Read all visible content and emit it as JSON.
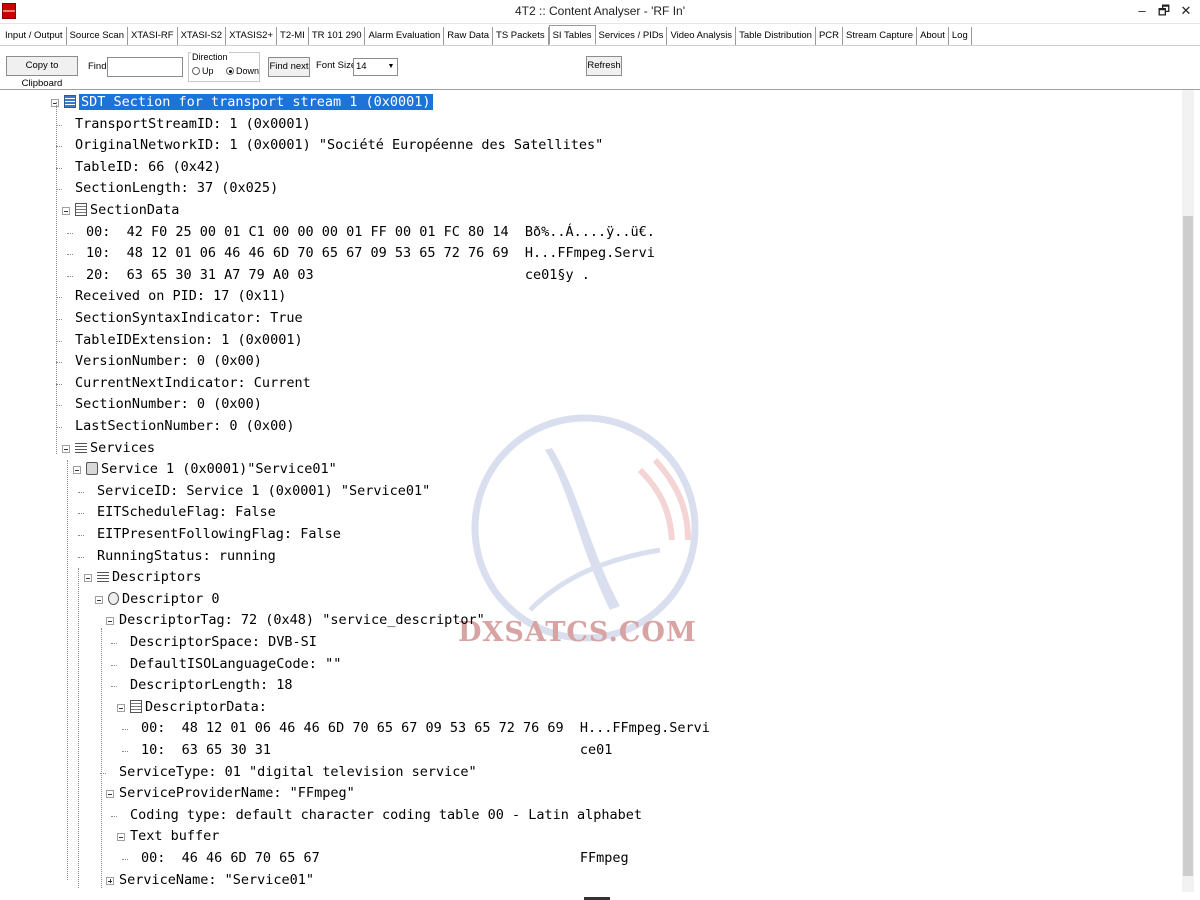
{
  "window": {
    "title": "4T2 :: Content Analyser - 'RF In'",
    "minimize": "–",
    "maximize": "🗗",
    "close": "✕"
  },
  "tabs": [
    {
      "label": "Input / Output",
      "active": false
    },
    {
      "label": "Source Scan",
      "active": false
    },
    {
      "label": "XTASI-RF",
      "active": false
    },
    {
      "label": "XTASI-S2",
      "active": false
    },
    {
      "label": "XTASIS2+",
      "active": false
    },
    {
      "label": "T2-MI",
      "active": false
    },
    {
      "label": "TR 101 290",
      "active": false
    },
    {
      "label": "Alarm Evaluation",
      "active": false
    },
    {
      "label": "Raw Data",
      "active": false
    },
    {
      "label": "TS Packets",
      "active": false
    },
    {
      "label": "SI Tables",
      "active": true
    },
    {
      "label": "Services / PIDs",
      "active": false
    },
    {
      "label": "Video Analysis",
      "active": false
    },
    {
      "label": "Table Distribution",
      "active": false
    },
    {
      "label": "PCR",
      "active": false
    },
    {
      "label": "Stream Capture",
      "active": false
    },
    {
      "label": "About",
      "active": false
    },
    {
      "label": "Log",
      "active": false
    }
  ],
  "toolbar": {
    "copy_label": "Copy to Clipboard",
    "find_label": "Find",
    "find_value": "",
    "direction_label": "Direction",
    "up_label": "Up",
    "down_label": "Down",
    "direction_selected": "Down",
    "find_next_label": "Find next",
    "font_size_label": "Font Size",
    "font_size_value": "14",
    "refresh_label": "Refresh"
  },
  "tree": [
    {
      "text": "SDT Section for transport stream 1 (0x0001)",
      "exp": "minus",
      "icon": "table",
      "selected": true
    },
    {
      "text": "TransportStreamID: 1 (0x0001)"
    },
    {
      "text": "OriginalNetworkID: 1 (0x0001) \"Société Européenne des Satellites\""
    },
    {
      "text": "TableID: 66 (0x42)"
    },
    {
      "text": "SectionLength: 37 (0x025)"
    },
    {
      "text": "SectionData",
      "exp": "minus",
      "icon": "hex"
    },
    {
      "text": "00:  42 F0 25 00 01 C1 00 00 00 01 FF 00 01 FC 80 14  Bð%..Á....ÿ..ü€."
    },
    {
      "text": "10:  48 12 01 06 46 46 6D 70 65 67 09 53 65 72 76 69  H...FFmpeg.Servi"
    },
    {
      "text": "20:  63 65 30 31 A7 79 A0 03                          ce01§y ."
    },
    {
      "text": "Received on PID: 17 (0x11)"
    },
    {
      "text": "SectionSyntaxIndicator: True"
    },
    {
      "text": "TableIDExtension: 1 (0x0001)"
    },
    {
      "text": "VersionNumber: 0 (0x00)"
    },
    {
      "text": "CurrentNextIndicator: Current"
    },
    {
      "text": "SectionNumber: 0 (0x00)"
    },
    {
      "text": "LastSectionNumber: 0 (0x00)"
    },
    {
      "text": "Services",
      "exp": "minus",
      "icon": "list"
    },
    {
      "text": "Service 1 (0x0001)\"Service01\"",
      "exp": "minus",
      "icon": "service"
    },
    {
      "text": "ServiceID: Service 1 (0x0001) \"Service01\""
    },
    {
      "text": "EITScheduleFlag: False"
    },
    {
      "text": "EITPresentFollowingFlag: False"
    },
    {
      "text": "RunningStatus: running"
    },
    {
      "text": "Descriptors",
      "exp": "minus",
      "icon": "list"
    },
    {
      "text": "Descriptor 0",
      "exp": "minus",
      "icon": "desc"
    },
    {
      "text": "DescriptorTag: 72 (0x48) \"service_descriptor\"",
      "exp": "minus"
    },
    {
      "text": "DescriptorSpace: DVB-SI"
    },
    {
      "text": "DefaultISOLanguageCode: \"\""
    },
    {
      "text": "DescriptorLength: 18"
    },
    {
      "text": "DescriptorData:",
      "exp": "minus",
      "icon": "hex"
    },
    {
      "text": "00:  48 12 01 06 46 46 6D 70 65 67 09 53 65 72 76 69  H...FFmpeg.Servi"
    },
    {
      "text": "10:  63 65 30 31                                      ce01"
    },
    {
      "text": "ServiceType: 01 \"digital television service\""
    },
    {
      "text": "ServiceProviderName: \"FFmpeg\"",
      "exp": "minus"
    },
    {
      "text": "Coding type: default character coding table 00 - Latin alphabet"
    },
    {
      "text": "Text buffer",
      "exp": "minus"
    },
    {
      "text": "00:  46 46 6D 70 65 67                                FFmpeg"
    },
    {
      "text": "ServiceName: \"Service01\"",
      "exp": "plus"
    }
  ],
  "watermark": {
    "text": "DXSATCS.COM"
  },
  "colors": {
    "selection": "#1e73d8",
    "watermark": "#d8a3a3"
  }
}
